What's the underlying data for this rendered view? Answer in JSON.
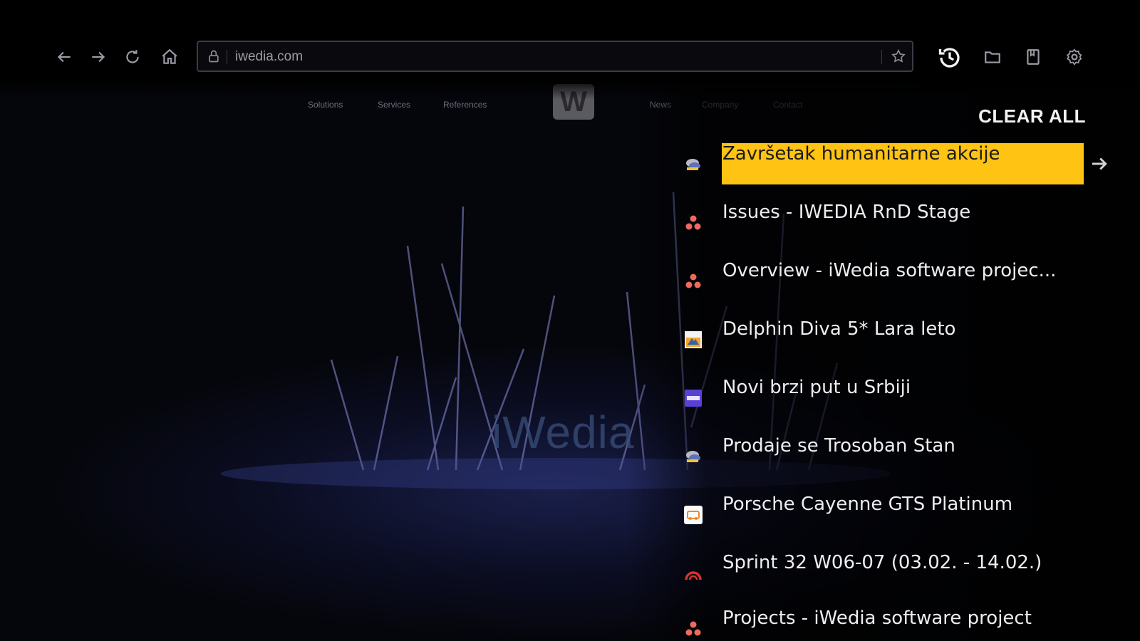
{
  "browser": {
    "url": "iwedia.com"
  },
  "site": {
    "nav_left": [
      "Solutions",
      "Services",
      "References"
    ],
    "nav_right": [
      "News",
      "Company",
      "Contact"
    ],
    "logo_letter": "W",
    "brand": "iWedia"
  },
  "history": {
    "clear_all_label": "CLEAR ALL",
    "items": [
      {
        "title": "Završetak humanitarne akcije",
        "favicon": "bubble-chat-icon",
        "selected": true
      },
      {
        "title": "Issues - IWEDIA RnD Stage",
        "favicon": "jira-dots-icon"
      },
      {
        "title": "Overview - iWedia software projec...",
        "favicon": "jira-dots-icon"
      },
      {
        "title": "Delphin Diva 5* Lara leto",
        "favicon": "travel-image-icon"
      },
      {
        "title": "Novi brzi put u Srbiji",
        "favicon": "purple-badge-icon"
      },
      {
        "title": "Prodaje se Trosoban Stan",
        "favicon": "bubble-chat-icon"
      },
      {
        "title": "Porsche Cayenne GTS Platinum",
        "favicon": "orange-car-icon"
      },
      {
        "title": "Sprint 32 W06-07 (03.02. - 14.02.)",
        "favicon": "red-arc-icon"
      },
      {
        "title": "Projects - iWedia software project",
        "favicon": "jira-dots-icon"
      }
    ]
  },
  "colors": {
    "selection": "#ffc313",
    "background": "#06070d"
  }
}
